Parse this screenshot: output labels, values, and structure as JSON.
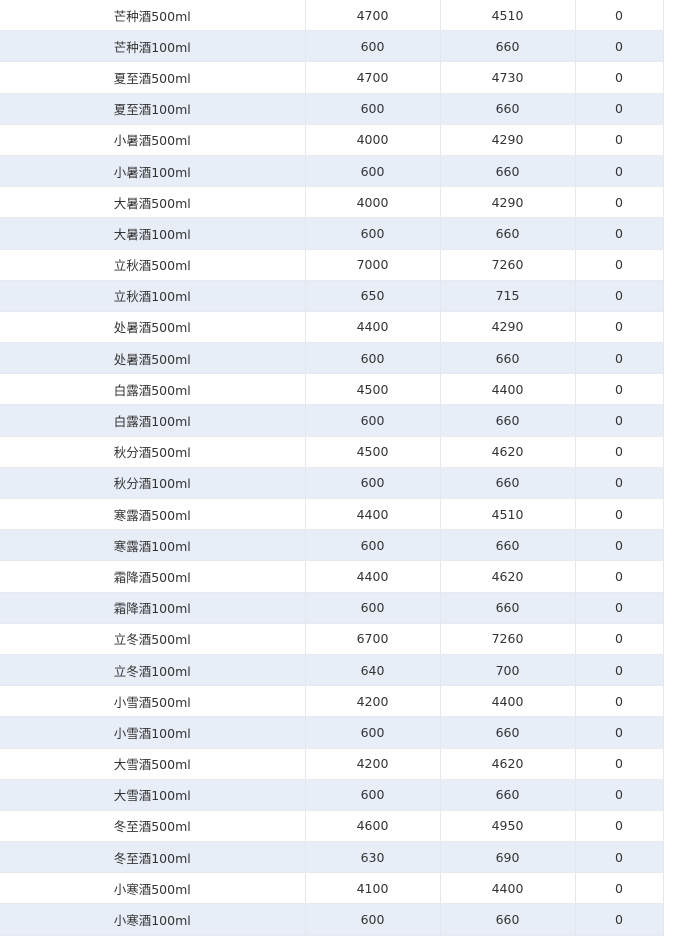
{
  "table": {
    "rows": [
      [
        "芒种酒500ml",
        "4700",
        "4510",
        "0"
      ],
      [
        "芒种酒100ml",
        "600",
        "660",
        "0"
      ],
      [
        "夏至酒500ml",
        "4700",
        "4730",
        "0"
      ],
      [
        "夏至酒100ml",
        "600",
        "660",
        "0"
      ],
      [
        "小暑酒500ml",
        "4000",
        "4290",
        "0"
      ],
      [
        "小暑酒100ml",
        "600",
        "660",
        "0"
      ],
      [
        "大暑酒500ml",
        "4000",
        "4290",
        "0"
      ],
      [
        "大暑酒100ml",
        "600",
        "660",
        "0"
      ],
      [
        "立秋酒500ml",
        "7000",
        "7260",
        "0"
      ],
      [
        "立秋酒100ml",
        "650",
        "715",
        "0"
      ],
      [
        "处暑酒500ml",
        "4400",
        "4290",
        "0"
      ],
      [
        "处暑酒500ml",
        "600",
        "660",
        "0"
      ],
      [
        "白露酒500ml",
        "4500",
        "4400",
        "0"
      ],
      [
        "白露酒100ml",
        "600",
        "660",
        "0"
      ],
      [
        "秋分酒500ml",
        "4500",
        "4620",
        "0"
      ],
      [
        "秋分酒100ml",
        "600",
        "660",
        "0"
      ],
      [
        "寒露酒500ml",
        "4400",
        "4510",
        "0"
      ],
      [
        "寒露酒100ml",
        "600",
        "660",
        "0"
      ],
      [
        "霜降酒500ml",
        "4400",
        "4620",
        "0"
      ],
      [
        "霜降酒100ml",
        "600",
        "660",
        "0"
      ],
      [
        "立冬酒500ml",
        "6700",
        "7260",
        "0"
      ],
      [
        "立冬酒100ml",
        "640",
        "700",
        "0"
      ],
      [
        "小雪酒500ml",
        "4200",
        "4400",
        "0"
      ],
      [
        "小雪酒100ml",
        "600",
        "660",
        "0"
      ],
      [
        "大雪酒500ml",
        "4200",
        "4620",
        "0"
      ],
      [
        "大雪酒100ml",
        "600",
        "660",
        "0"
      ],
      [
        "冬至酒500ml",
        "4600",
        "4950",
        "0"
      ],
      [
        "冬至酒100ml",
        "630",
        "690",
        "0"
      ],
      [
        "小寒酒500ml",
        "4100",
        "4400",
        "0"
      ],
      [
        "小寒酒100ml",
        "600",
        "660",
        "0"
      ]
    ]
  }
}
